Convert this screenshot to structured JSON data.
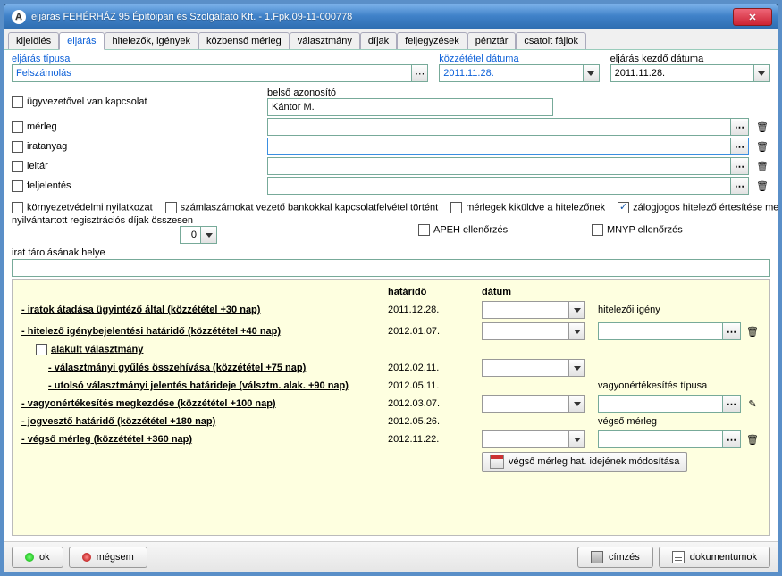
{
  "titlebar": {
    "icon_letter": "A",
    "title": "eljárás FEHÉRHÁZ 95 Építőipari és Szolgáltató Kft. - 1.Fpk.09-11-000778"
  },
  "tabs": [
    "kijelölés",
    "eljárás",
    "hitelezők, igények",
    "közbenső mérleg",
    "választmány",
    "díjak",
    "feljegyzések",
    "pénztár",
    "csatolt fájlok"
  ],
  "active_tab_index": 1,
  "header": {
    "type_label": "eljárás típusa",
    "type_value": "Felszámolás",
    "pub_label": "közzététel dátuma",
    "pub_value": "2011.11.28.",
    "start_label": "eljárás kezdő dátuma",
    "start_value": "2011.11.28."
  },
  "fields": {
    "contact": "ügyvezetővel van kapcsolat",
    "internal_id_label": "belső azonosító",
    "internal_id_value": "Kántor M.",
    "merleg": "mérleg",
    "iratanyag": "iratanyag",
    "leltar": "leltár",
    "feljelentes": "feljelentés"
  },
  "checks": {
    "korny": "környezetvédelmi nyilatkozat",
    "szamla": "számlaszámokat vezető bankokkal kapcsolatfelvétel történt",
    "merlegki": "mérlegek kiküldve a hitelezőnek",
    "zalog": "zálogjogos hitelező értesítése megtörtént",
    "apeh": "APEH ellenőrzés",
    "mnyp": "MNYP ellenőrzés"
  },
  "reg_label": "nyilvántartott regisztrációs díjak összesen",
  "reg_value": "0",
  "storage_label": "irat tárolásának helye",
  "table": {
    "hdr_deadline": "határidő",
    "hdr_date": "dátum",
    "rows": [
      {
        "label": "- iratok átadása ügyintéző által (közzététel +30 nap)",
        "deadline": "2011.12.28.",
        "date": ""
      },
      {
        "label": "- hitelező igénybejelentési határidő (közzététel +40 nap)",
        "deadline": "2012.01.07.",
        "date": ""
      },
      {
        "label": "alakult választmány",
        "deadline": "",
        "date": "",
        "checkbox": true
      },
      {
        "label": "- választmányi gyűlés összehívása (közzététel +75 nap)",
        "deadline": "2012.02.11.",
        "date": "",
        "indent": 2
      },
      {
        "label": "- utolsó választmányi jelentés határideje (válsztm. alak. +90 nap)",
        "deadline": "2012.05.11.",
        "date": "",
        "indent": 2
      },
      {
        "label": "- vagyonértékesítés megkezdése (közzététel +100 nap)",
        "deadline": "2012.03.07.",
        "date": ""
      },
      {
        "label": "- jogvesztő határidő (közzététel +180 nap)",
        "deadline": "2012.05.26.",
        "date": ""
      },
      {
        "label": "- végső mérleg (közzététel +360 nap)",
        "deadline": "2012.11.22.",
        "date": ""
      }
    ],
    "side": {
      "hitelezoi": "hitelezői igény",
      "vagyon": "vagyonértékesítés típusa",
      "vegso": "végső mérleg"
    },
    "modbtn": "végső mérleg hat. idejének módosítása"
  },
  "buttons": {
    "ok": "ok",
    "cancel": "mégsem",
    "cimzes": "címzés",
    "dokumentumok": "dokumentumok"
  }
}
